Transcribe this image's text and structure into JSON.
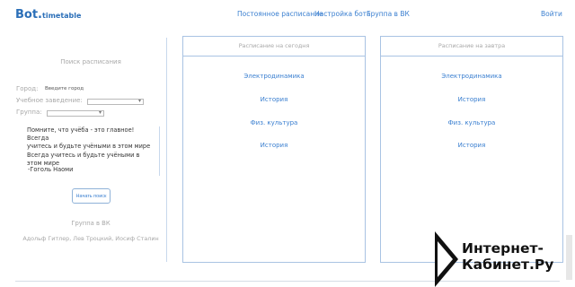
{
  "header": {
    "logo_main": "Bot.",
    "logo_sub": "timetable",
    "nav": [
      {
        "label": "Постоянное расписание"
      },
      {
        "label": "Настройка бота"
      },
      {
        "label": "Группа в ВК"
      }
    ],
    "login_label": "Войти"
  },
  "sidebar": {
    "search_title": "Поиск расписания",
    "city_label": "Город:",
    "city_value": "Введите город",
    "institution_label": "Учебное заведение:",
    "group_label": "Группа:",
    "quote_lines": [
      "Помните, что учёба - это главное! Всегда",
      "учитесь и будьте учёными в этом мире",
      "Всегда учитесь и будьте учёными в этом мире"
    ],
    "quote_author": "-Гоголь Наоми",
    "start_button": "Начать поиск",
    "vk_group": "Группа в ВК",
    "authors": "Адольф Гитлер, Лев Троцкий, Иосиф Сталин"
  },
  "today": {
    "title": "Расписание на сегодня",
    "lessons": [
      "Электродинамика",
      "История",
      "Физ. культура",
      "История"
    ]
  },
  "tomorrow": {
    "title": "Расписание на завтра",
    "lessons": [
      "Электродинамика",
      "История",
      "Физ. культура",
      "История"
    ]
  },
  "watermark": {
    "line1": "Интернет-",
    "line2": "Кабинет.Ру"
  }
}
